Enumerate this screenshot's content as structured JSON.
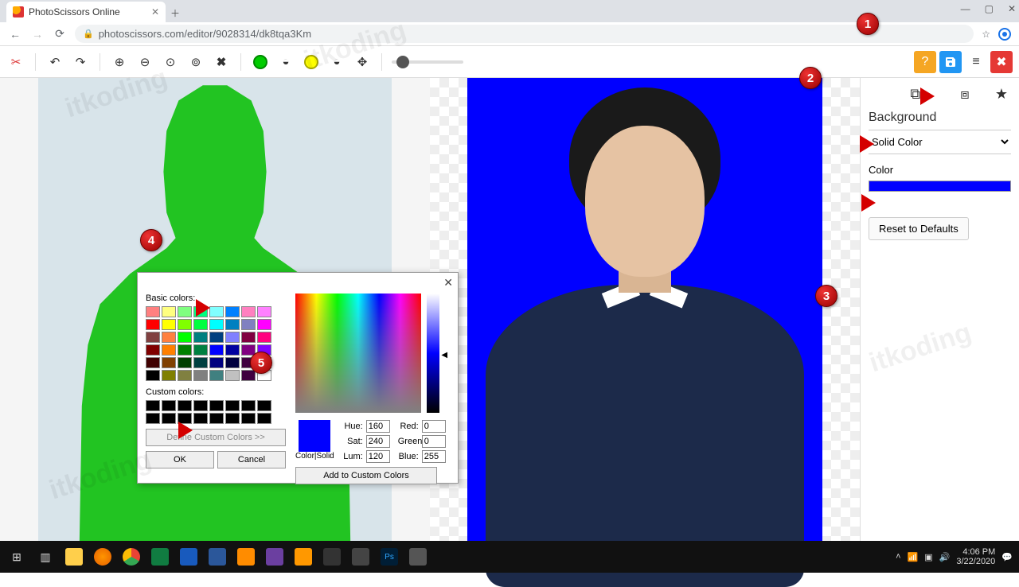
{
  "browser": {
    "tab_title": "PhotoScissors Online",
    "url": "photoscissors.com/editor/9028314/dk8tqa3Km",
    "window_minimize": "—",
    "window_maximize": "▢",
    "window_close": "✕"
  },
  "toolbar": {
    "logo": "✂",
    "undo": "↶",
    "redo": "↷",
    "zoom_in": "⊕",
    "zoom_out": "⊖",
    "zoom_fit": "⊙",
    "zoom_1to1": "⊚",
    "clear": "✖",
    "fg_marker": "●",
    "fg_erase": "◒",
    "bg_marker": "●",
    "bg_erase": "◒",
    "pan": "✥",
    "help": "?",
    "save": "💾",
    "menu": "≡",
    "close": "✖"
  },
  "sidebar": {
    "tab_fg_icon": "⧉",
    "tab_bg_icon": "⧈",
    "star_icon": "★",
    "heading": "Background",
    "mode_select": "Solid Color",
    "color_label": "Color",
    "reset": "Reset to Defaults"
  },
  "dialog": {
    "basic_label": "Basic colors:",
    "custom_label": "Custom colors:",
    "define": "Define Custom Colors >>",
    "ok": "OK",
    "cancel": "Cancel",
    "colorsolid": "Color|Solid",
    "addcustom": "Add to Custom Colors",
    "hue_l": "Hue:",
    "sat_l": "Sat:",
    "lum_l": "Lum:",
    "red_l": "Red:",
    "green_l": "Green:",
    "blue_l": "Blue:",
    "hue": "160",
    "sat": "240",
    "lum": "120",
    "red": "0",
    "green": "0",
    "blue": "255",
    "basic_colors": [
      "#ff8080",
      "#ffff80",
      "#80ff80",
      "#00ff80",
      "#80ffff",
      "#0080ff",
      "#ff80c0",
      "#ff80ff",
      "#ff0000",
      "#ffff00",
      "#80ff00",
      "#00ff40",
      "#00ffff",
      "#0080c0",
      "#8080c0",
      "#ff00ff",
      "#804040",
      "#ff8040",
      "#00ff00",
      "#008080",
      "#004080",
      "#8080ff",
      "#800040",
      "#ff0080",
      "#800000",
      "#ff8000",
      "#008000",
      "#008040",
      "#0000ff",
      "#0000a0",
      "#800080",
      "#8000ff",
      "#400000",
      "#804000",
      "#004000",
      "#004040",
      "#000080",
      "#000040",
      "#400040",
      "#400080",
      "#000000",
      "#808000",
      "#808040",
      "#808080",
      "#408080",
      "#c0c0c0",
      "#400040",
      "#ffffff"
    ]
  },
  "annotations": {
    "m1": "1",
    "m2": "2",
    "m3": "3",
    "m4": "4",
    "m5": "5"
  },
  "watermark": "itkoding",
  "taskbar": {
    "time": "4:06 PM",
    "date": "3/22/2020"
  }
}
